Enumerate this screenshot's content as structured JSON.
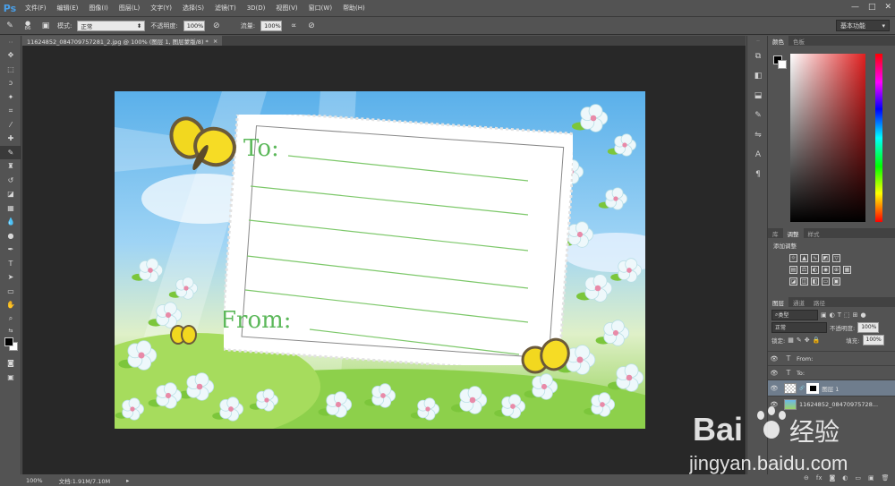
{
  "app": {
    "logo": "Ps"
  },
  "menu": [
    "文件(F)",
    "编辑(E)",
    "图像(I)",
    "图层(L)",
    "文字(Y)",
    "选择(S)",
    "滤镜(T)",
    "3D(D)",
    "视图(V)",
    "窗口(W)",
    "帮助(H)"
  ],
  "window_controls": {
    "minimize": "—",
    "maximize": "□",
    "close": "✕"
  },
  "options": {
    "brush_size": "86",
    "mode_label": "模式:",
    "mode_value": "正常",
    "opacity_label": "不透明度:",
    "opacity_value": "100%",
    "flow_label": "流量:",
    "flow_value": "100%",
    "workspace": "基本功能"
  },
  "document": {
    "tab_title": "11624852_084709757281_2.jpg @ 100% (图层 1, 图层蒙版/8) *",
    "close": "×",
    "zoom": "100%",
    "doc_size": "文档:1.91M/7.10M",
    "card_to": "To:",
    "card_from": "From:"
  },
  "panels": {
    "color_tabs": [
      "颜色",
      "色板"
    ],
    "adjust_tabs": [
      "库",
      "调整",
      "样式"
    ],
    "adjust_title": "添加调整",
    "layers_tabs": [
      "图层",
      "通道",
      "路径"
    ],
    "filter_kind": "类型",
    "blend_mode": "正常",
    "opacity_label": "不透明度:",
    "opacity_value": "100%",
    "lock_label": "锁定:",
    "fill_label": "填充:",
    "fill_value": "100%",
    "layers": [
      {
        "name": "From:",
        "kind": "T"
      },
      {
        "name": "To:",
        "kind": "T"
      },
      {
        "name": "图层 1",
        "kind": "raster"
      },
      {
        "name": "11624852_08470975728...",
        "kind": "raster"
      }
    ]
  },
  "watermark": {
    "brand": "Bai",
    "brand_tail": "经验",
    "url": "jingyan.baidu.com"
  }
}
